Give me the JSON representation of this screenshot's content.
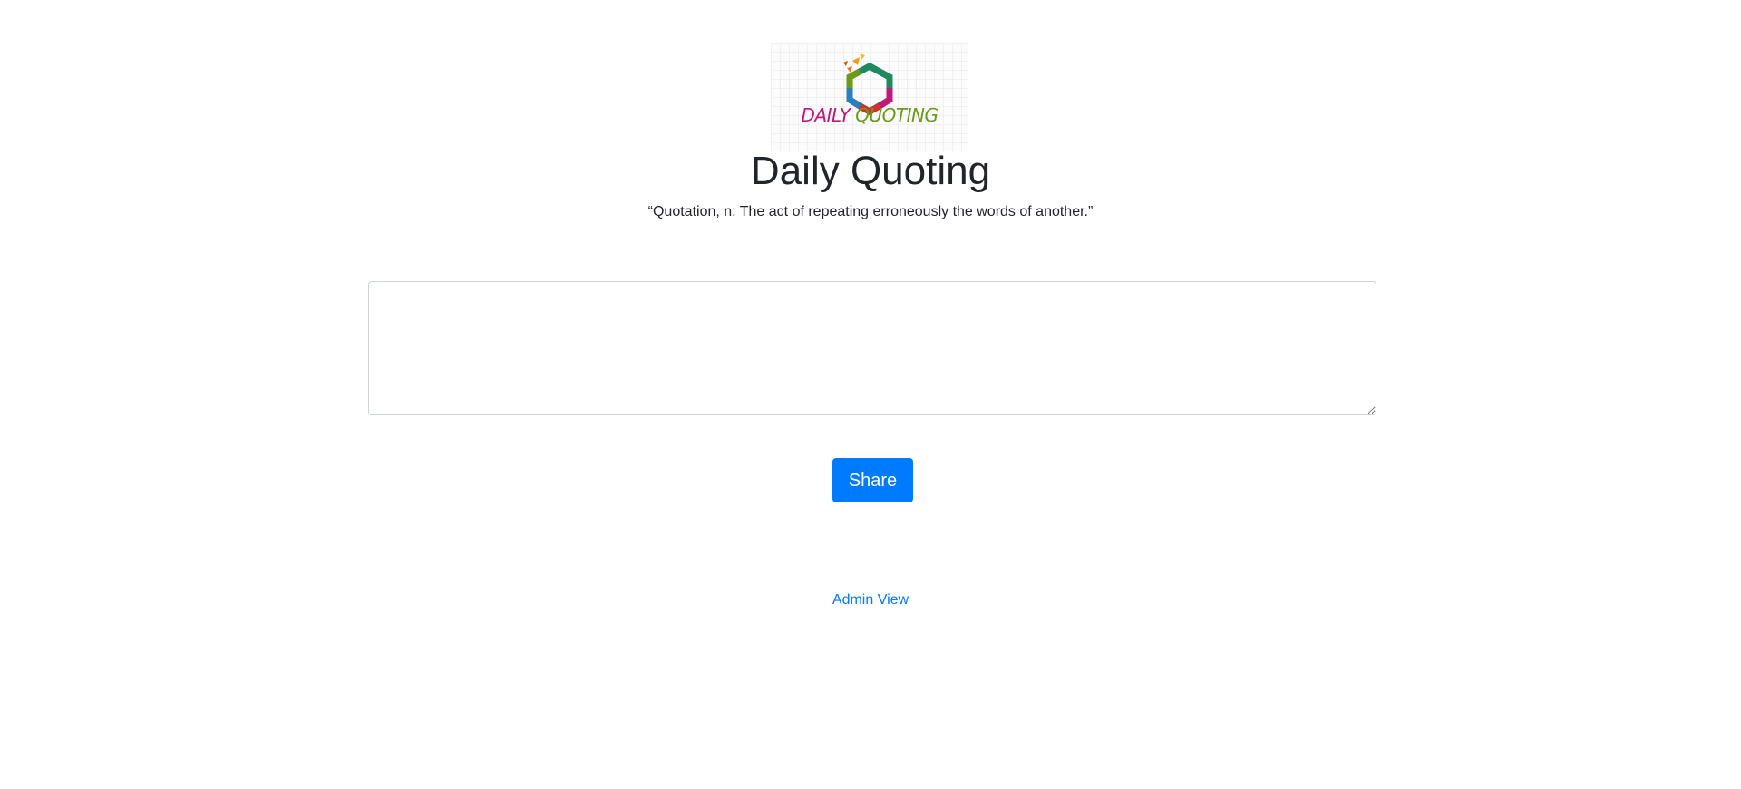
{
  "logo": {
    "word1": "DAILY",
    "word2": "QUOTING",
    "colors": {
      "daily": "#c2187a",
      "quoting": "#6b9a1c",
      "hexagon": [
        "#1f8a5e",
        "#2a7fc1",
        "#c2187a",
        "#d32f2f",
        "#f39c12",
        "#6b9a1c"
      ]
    }
  },
  "header": {
    "title": "Daily Quoting",
    "subtitle": "“Quotation, n: The act of repeating erroneously the words of another.”"
  },
  "form": {
    "quote_value": "",
    "share_label": "Share"
  },
  "footer": {
    "admin_link_label": "Admin View"
  },
  "colors": {
    "primary": "#007bff",
    "text": "#212529",
    "border": "#ced4da"
  }
}
